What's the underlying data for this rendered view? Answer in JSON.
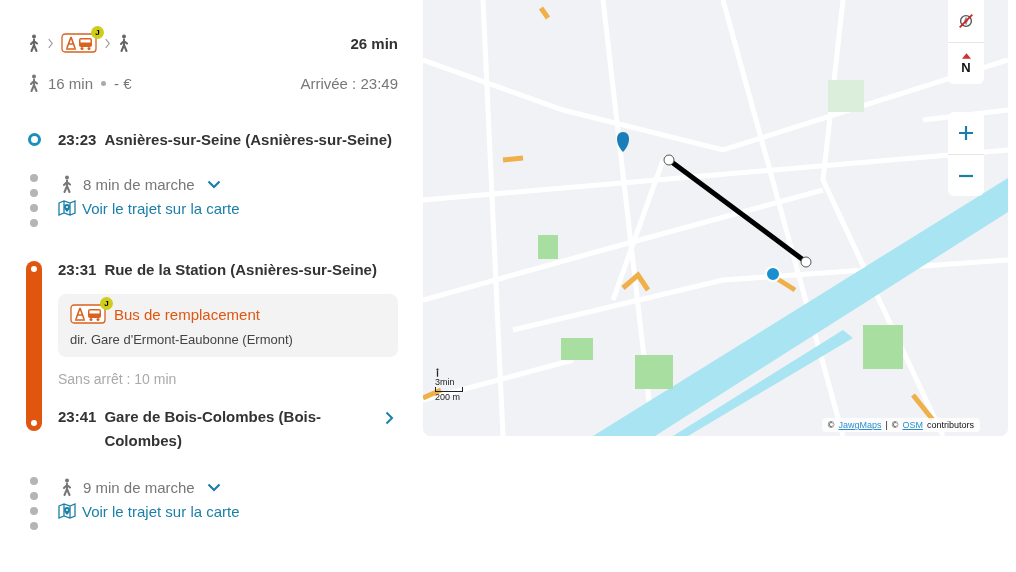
{
  "summary": {
    "modes": [
      {
        "kind": "walk"
      },
      {
        "kind": "replacement-bus",
        "badge": "J"
      },
      {
        "kind": "walk"
      }
    ],
    "duration": "26 min",
    "walk_time": "16 min",
    "price": "- €",
    "arrival": "Arrivée : 23:49"
  },
  "steps": [
    {
      "kind": "stop",
      "time": "23:23",
      "name": "Asnières-sur-Seine (Asnières-sur-Seine)"
    },
    {
      "kind": "walk",
      "duration": "8 min de marche",
      "link": "Voir le trajet sur la carte"
    },
    {
      "kind": "ride",
      "color": "#e0560f",
      "start_time": "23:31",
      "start_name": "Rue de la Station (Asnières-sur-Seine)",
      "line": "Bus de remplacement",
      "badge": "J",
      "direction": "dir. Gare d'Ermont-Eaubonne (Ermont)",
      "stops": "Sans arrêt : 10 min",
      "end_time": "23:41",
      "end_name": "Gare de Bois-Colombes (Bois-Colombes)"
    },
    {
      "kind": "walk",
      "duration": "9 min de marche",
      "link": "Voir le trajet sur la carte"
    }
  ],
  "map": {
    "north_label": "N",
    "scale_time": "3min",
    "scale_distance": "200 m",
    "attribution": [
      {
        "kind": "text",
        "text": "©"
      },
      {
        "kind": "link",
        "text": "JawgMaps"
      },
      {
        "kind": "text",
        "text": "|"
      },
      {
        "kind": "text",
        "text": "©"
      },
      {
        "kind": "link",
        "text": "OSM"
      },
      {
        "kind": "text",
        "text": "contributors"
      }
    ]
  }
}
